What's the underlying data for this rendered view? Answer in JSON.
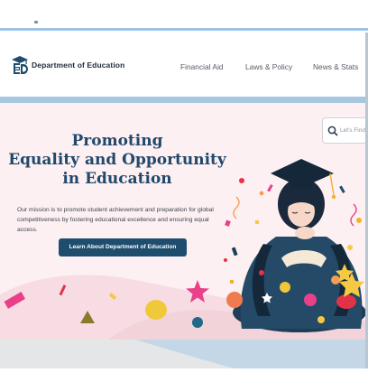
{
  "header": {
    "brand": "Department of Education",
    "nav": [
      {
        "label": "Financial Aid"
      },
      {
        "label": "Laws & Policy"
      },
      {
        "label": "News & Stats"
      }
    ]
  },
  "hero": {
    "title_lines": [
      "Promoting",
      "Equality and Opportunity",
      "in Education"
    ],
    "mission": "Our mission is to promote student achievement and preparation for global competitiveness by fostering educational excellence and ensuring equal access.",
    "cta_label": "Learn About Department of Education",
    "search": {
      "placeholder": "Let's Find"
    }
  },
  "colors": {
    "title": "#22486a",
    "cta": "#1e4d6e",
    "hero_bg": "#fcf0f2",
    "band": "#a9c6df"
  },
  "icons": [
    "ed-logo-icon",
    "search-icon",
    "graduate-illustration",
    "confetti-decoration"
  ]
}
